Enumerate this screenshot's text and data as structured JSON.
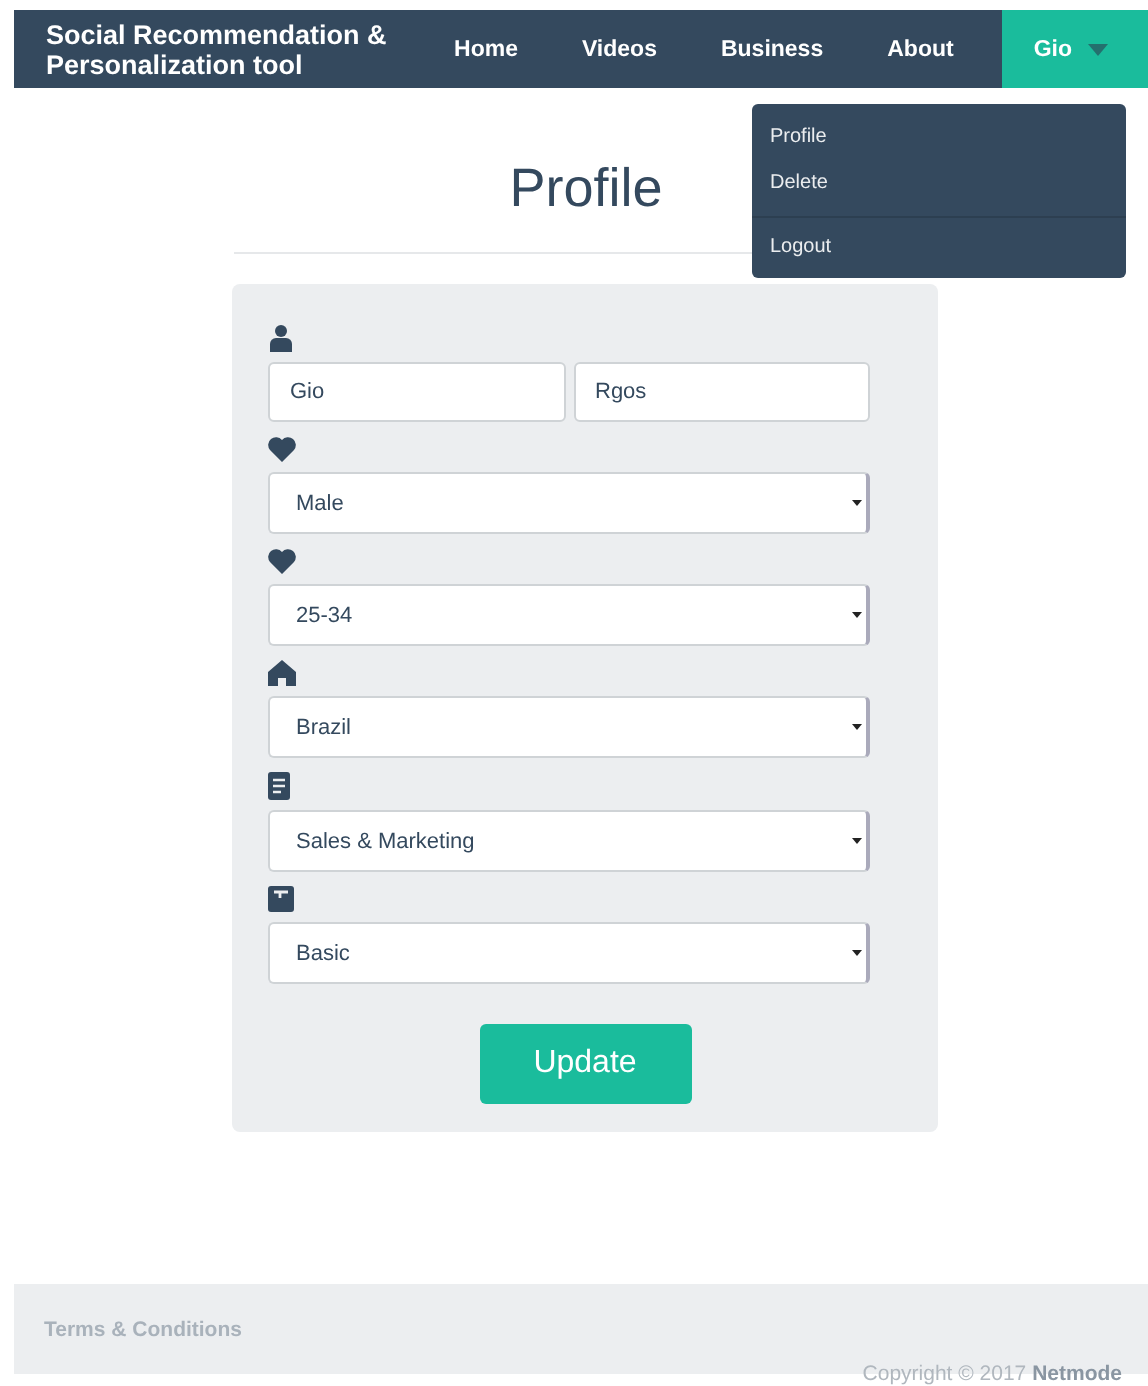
{
  "navbar": {
    "brand": "Social Recommendation & Personalization tool",
    "items": [
      {
        "label": "Home"
      },
      {
        "label": "Videos"
      },
      {
        "label": "Business"
      },
      {
        "label": "About"
      }
    ],
    "user_menu": {
      "label": "Gio",
      "open": true,
      "items": [
        {
          "label": "Profile",
          "separated": false
        },
        {
          "label": "Delete",
          "separated": false
        },
        {
          "label": "Logout",
          "separated": true
        }
      ]
    }
  },
  "title": "Profile",
  "form": {
    "rows": [
      {
        "fields": [
          {
            "kind": "text",
            "value": "Gio"
          },
          {
            "kind": "text",
            "value": "Rgos"
          }
        ]
      },
      {
        "fields": [
          {
            "kind": "select",
            "value": "Male"
          }
        ]
      },
      {
        "fields": [
          {
            "kind": "select",
            "value": "25-34"
          }
        ]
      },
      {
        "fields": [
          {
            "kind": "select",
            "value": "Brazil"
          }
        ]
      },
      {
        "fields": [
          {
            "kind": "select",
            "value": "Sales & Marketing"
          }
        ]
      },
      {
        "fields": [
          {
            "kind": "select",
            "value": "Basic"
          }
        ]
      }
    ],
    "button": "Update"
  },
  "footer": {
    "link": "Terms & Conditions",
    "copyright": "Copyright © 2017 **Netmode**"
  }
}
